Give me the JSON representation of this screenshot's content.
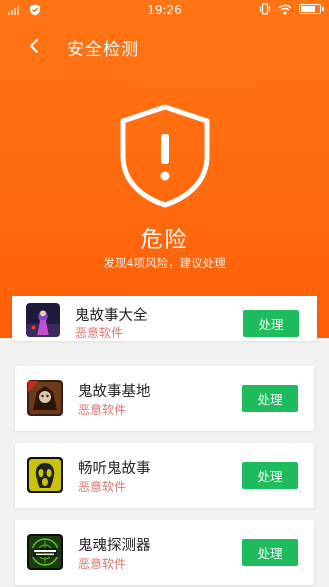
{
  "status_bar": {
    "time": "19:26",
    "icons": [
      "signal-icon",
      "shield-check-icon",
      "vibrate-icon",
      "wifi-icon",
      "battery-icon"
    ]
  },
  "header": {
    "title": "安全检测",
    "back_icon": "chevron-left-icon"
  },
  "risk": {
    "icon": "shield-alert-icon",
    "level": "危险",
    "summary": "发现4项风险，建议处理"
  },
  "colors": {
    "header_orange": "#ff6a0e",
    "action_green": "#1fbc5e",
    "tag_red": "#d9776f"
  },
  "apps": [
    {
      "name": "鬼故事大全",
      "tag": "恶意软件",
      "action": "处理"
    },
    {
      "name": "鬼故事基地",
      "tag": "恶意软件",
      "action": "处理"
    },
    {
      "name": "畅听鬼故事",
      "tag": "恶意软件",
      "action": "处理"
    },
    {
      "name": "鬼魂探测器",
      "tag": "恶意软件",
      "action": "处理"
    }
  ]
}
